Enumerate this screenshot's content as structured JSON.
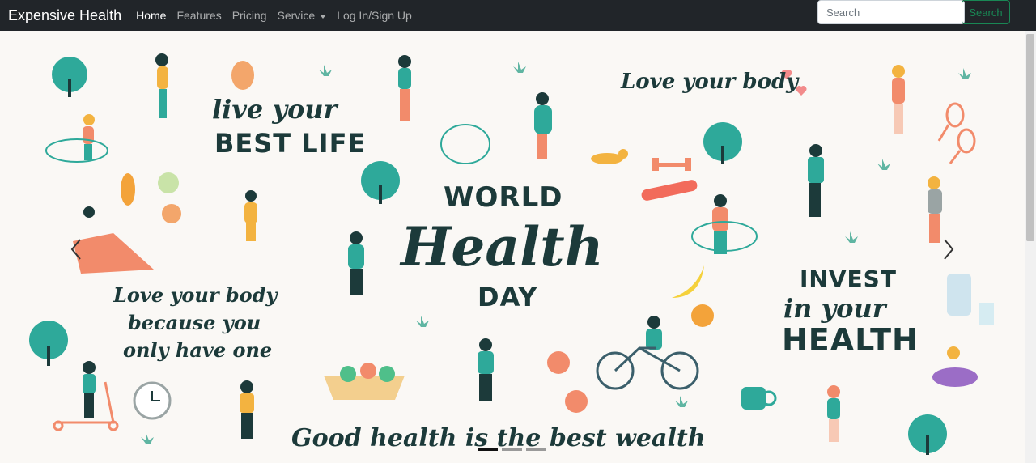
{
  "navbar": {
    "brand": "Expensive Health",
    "links": [
      "Home",
      "Features",
      "Pricing",
      "Service",
      "Log In/Sign Up"
    ]
  },
  "search": {
    "placeholder": "Search",
    "button_label": "Search"
  },
  "banner": {
    "live_line1": "live your",
    "live_line2": "BEST LIFE",
    "love_top": "Love your body",
    "world": "WORLD",
    "health": "Health",
    "day": "DAY",
    "because1": "Love your body",
    "because2": "because you",
    "because3": "only have one",
    "invest1": "INVEST",
    "invest2": "in your",
    "invest3": "HEALTH",
    "good": "Good health is the best wealth"
  },
  "carousel": {
    "active_slide": 1,
    "slide_count": 3
  },
  "colors": {
    "navbar_bg": "#212529",
    "accent_green": "#198754",
    "text_dark": "#1c3a3a",
    "tree_teal": "#2ea99a"
  }
}
